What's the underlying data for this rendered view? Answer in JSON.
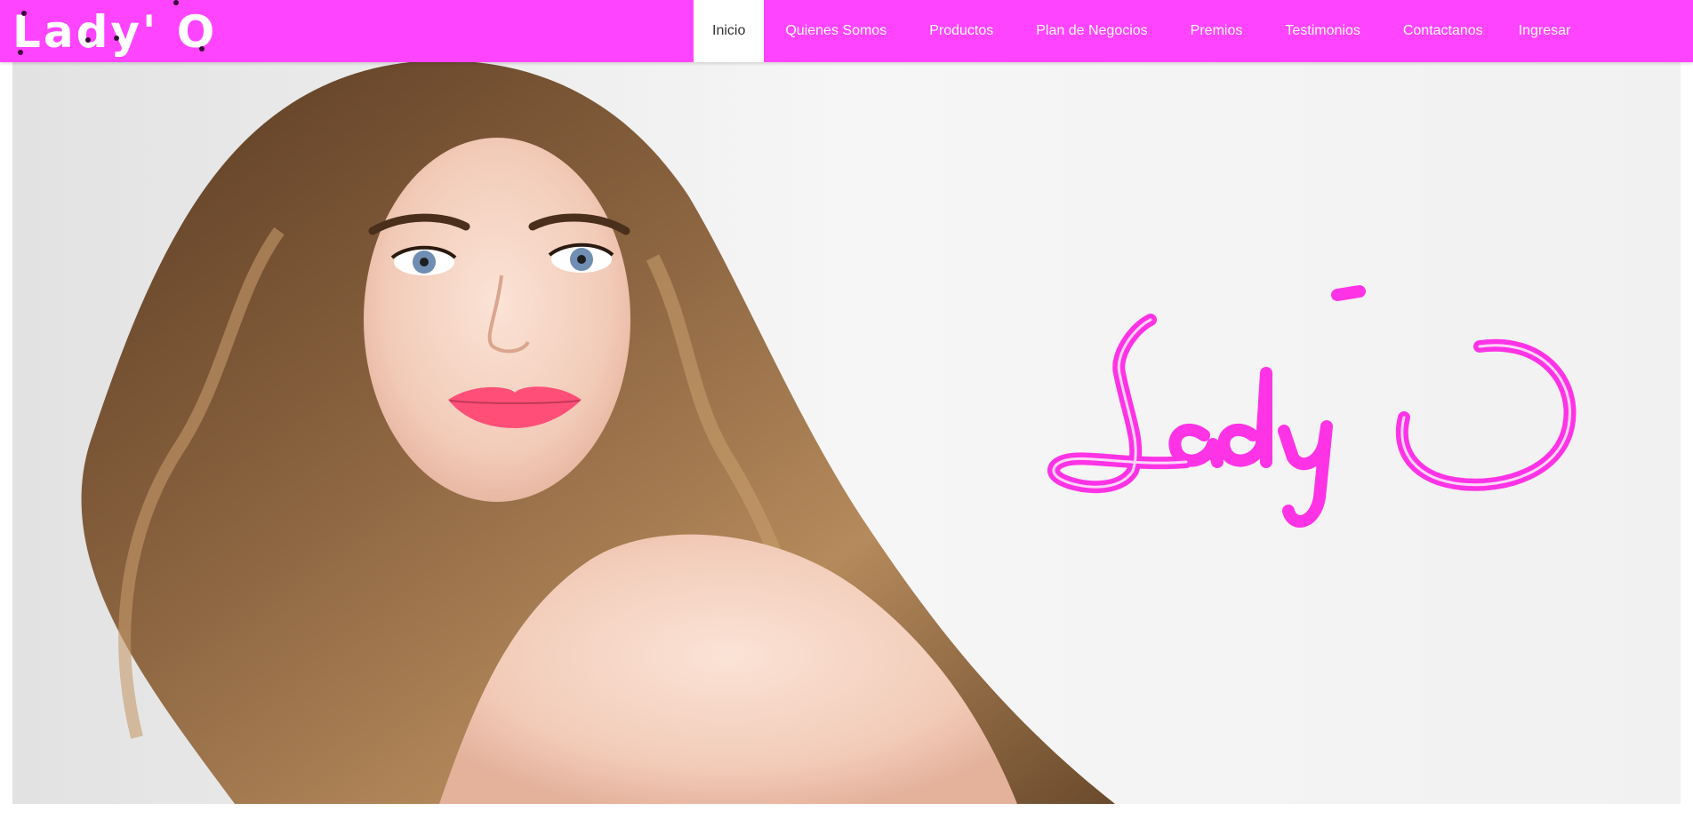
{
  "brand": {
    "name": "Lady' O",
    "color": "#ffffff"
  },
  "colors": {
    "navbar_bg": "#ff44ff",
    "active_tab_bg": "#ffffff",
    "logo_magenta": "#ff33e6"
  },
  "nav": {
    "items": [
      {
        "label": "Inicio",
        "active": true
      },
      {
        "label": "Quienes Somos"
      },
      {
        "label": "Productos"
      },
      {
        "label": "Plan de Negocios"
      },
      {
        "label": "Premios"
      },
      {
        "label": "Testimonios"
      },
      {
        "label": "Contactanos"
      },
      {
        "label": "Ingresar"
      }
    ]
  },
  "hero": {
    "logo_text": "Lady´O",
    "image": "hero-model-photo"
  }
}
